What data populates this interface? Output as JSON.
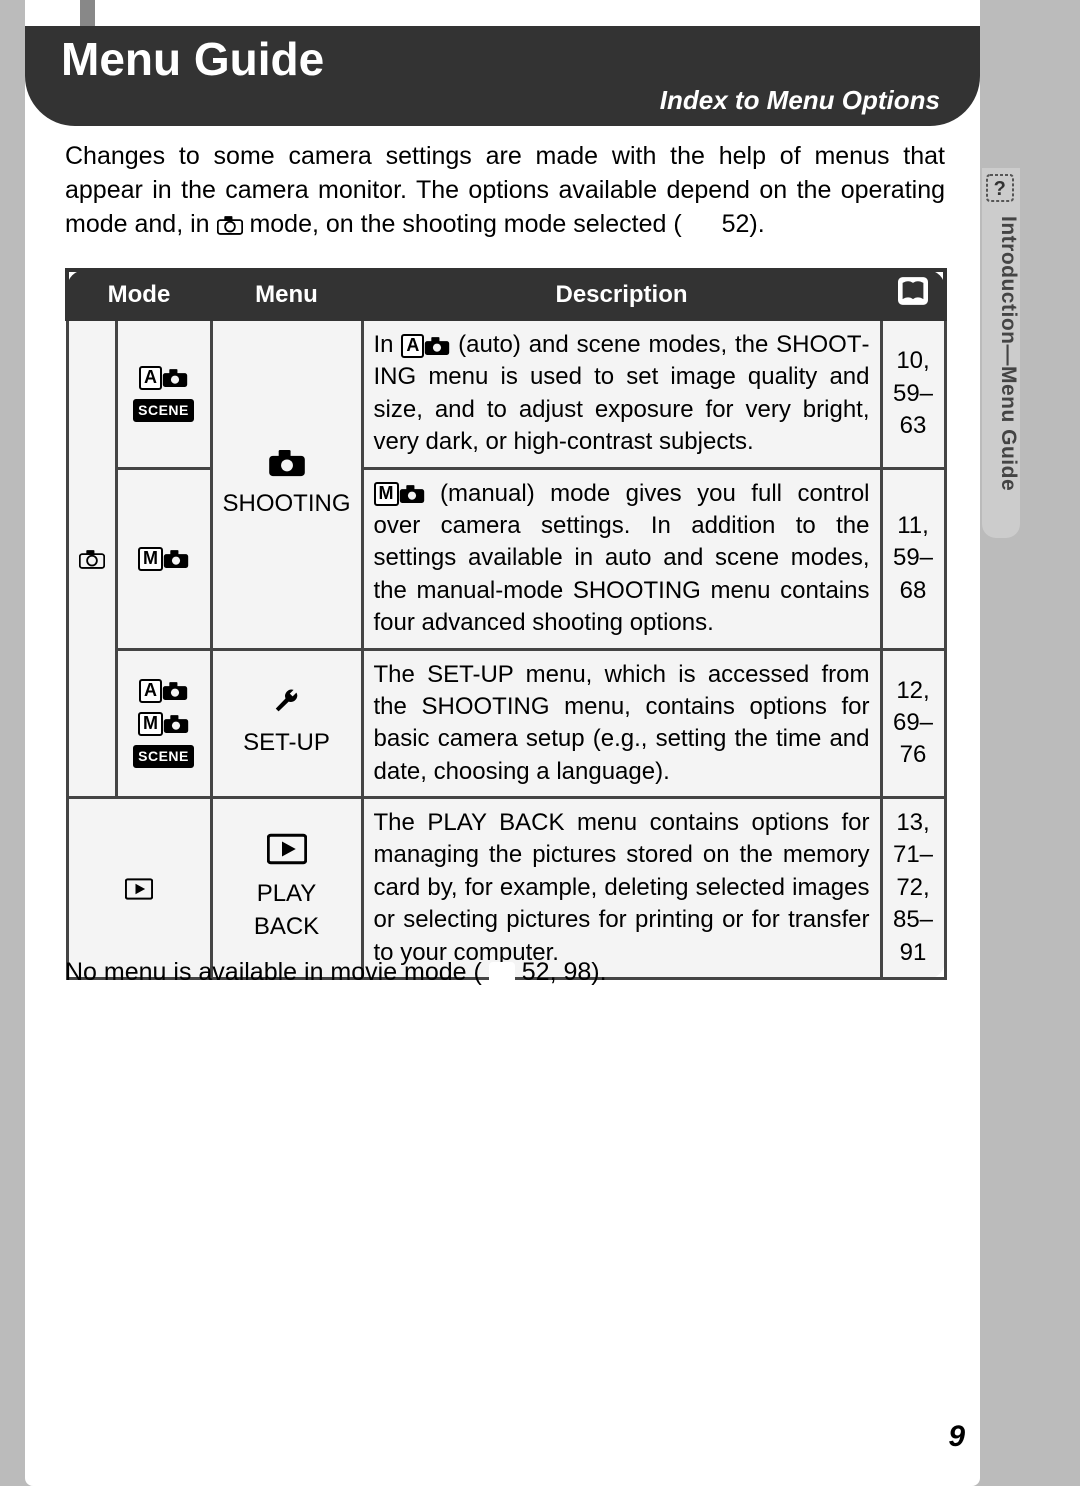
{
  "title": "Menu Guide",
  "subtitle": "Index to Menu Options",
  "intro_parts": {
    "p1": "Changes to some camera settings are made with the help of menus that appear in the camera monitor.  The options available depend on the operat­ing mode and, in ",
    "p2": " mode, on the shooting mode selected (",
    "p3": " 52)."
  },
  "columns": {
    "mode": "Mode",
    "menu": "Menu",
    "desc": "Description"
  },
  "rows": [
    {
      "menu": "SHOOTING",
      "desc_pre": "In ",
      "desc_post": " (auto) and scene modes, the SHOOT­ING menu is used to set image quality and size, and to adjust exposure for very bright, very dark, or high-contrast subjects.",
      "pages": "10, 59–63"
    },
    {
      "desc_pre": "",
      "desc_mid": " (manual) mode gives you full control over camera settings.  In addition to the settings avail­able in auto and scene modes, the manual-mode SHOOTING menu contains four advanced shooting options.",
      "pages": "11, 59–68"
    },
    {
      "menu": "SET-UP",
      "desc": "The SET-UP menu, which is accessed from the SHOOTING menu, contains options for basic camera setup (e.g., setting the time and date, choosing a language).",
      "pages": "12, 69–76"
    },
    {
      "menu": "PLAY BACK",
      "desc": "The PLAY BACK menu contains options for managing the pictures stored on the memory card by, for example, deleting selected images or selecting pictures for printing or for transfer to your computer.",
      "pages": "13, 71–72, 85–91"
    }
  ],
  "after_table": {
    "p1": "No menu is available in movie mode (",
    "p2": " 52, 98)."
  },
  "side_tab": "Introduction—Menu Guide",
  "page_number": "9"
}
